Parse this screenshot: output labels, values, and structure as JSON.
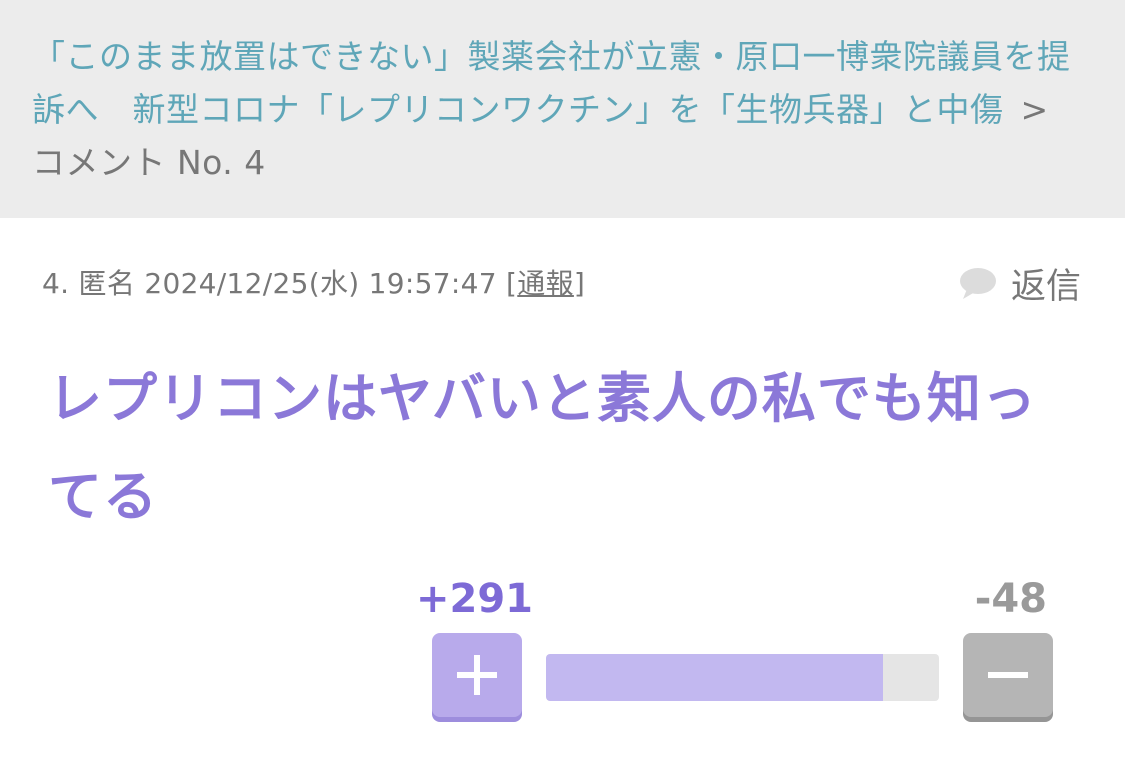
{
  "breadcrumb": {
    "article_link": "「このまま放置はできない」製薬会社が立憲・原口一博衆院議員を提訴へ　新型コロナ「レプリコンワクチン」を「生物兵器」と中傷",
    "separator": ">",
    "current": "コメント No. 4"
  },
  "comment": {
    "number": "4.",
    "author": "匿名",
    "timestamp": "2024/12/25(水) 19:57:47",
    "report_open": "[",
    "report_label": "通報",
    "report_close": "]",
    "reply_label": "返信",
    "reply_icon": "speech-bubble-icon",
    "body": "レプリコンはヤバいと素人の私でも知ってる"
  },
  "votes": {
    "plus": "+291",
    "minus": "-48",
    "plus_fraction": 0.858,
    "plus_icon": "plus-icon",
    "minus_icon": "minus-icon"
  },
  "colors": {
    "breadcrumb_bg": "#ececec",
    "link": "#5fa6b8",
    "comment_text": "#8b78d8",
    "plus_button": "#b8aaeb",
    "minus_button": "#b5b5b5",
    "bar_fill": "#c2b8f0",
    "bar_bg": "#e5e5e5"
  }
}
